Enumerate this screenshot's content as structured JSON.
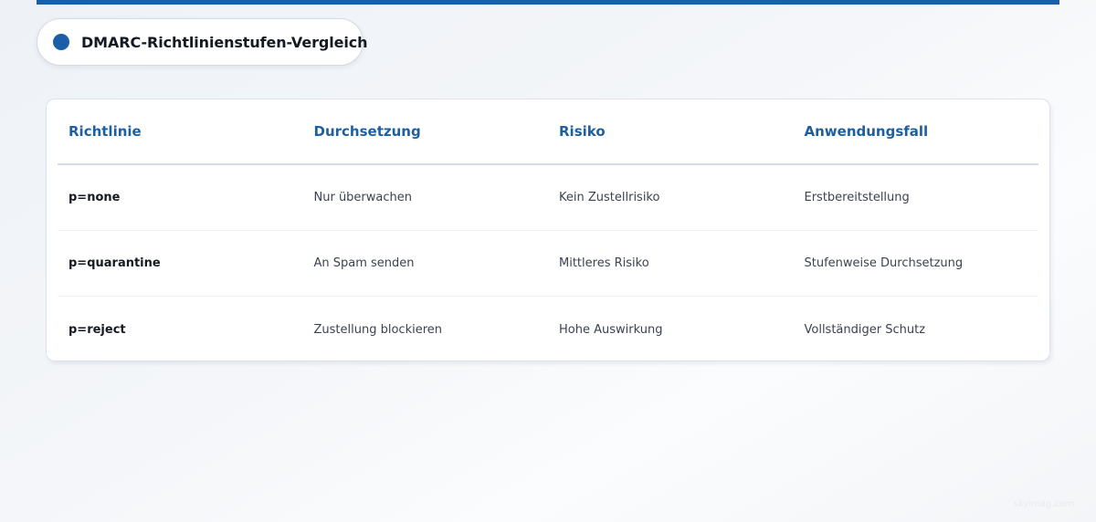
{
  "title": "DMARC-Richtlinienstufen-Vergleich",
  "colors": {
    "accent": "#1c5fa6",
    "header_text": "#1f5f9e"
  },
  "table": {
    "headers": [
      "Richtlinie",
      "Durchsetzung",
      "Risiko",
      "Anwendungsfall"
    ],
    "rows": [
      [
        "p=none",
        "Nur überwachen",
        "Kein Zustellrisiko",
        "Erstbereitstellung"
      ],
      [
        "p=quarantine",
        "An Spam senden",
        "Mittleres Risiko",
        "Stufenweise Durchsetzung"
      ],
      [
        "p=reject",
        "Zustellung blockieren",
        "Hohe Auswirkung",
        "Vollständiger Schutz"
      ]
    ]
  },
  "watermark": "skyimag.com"
}
